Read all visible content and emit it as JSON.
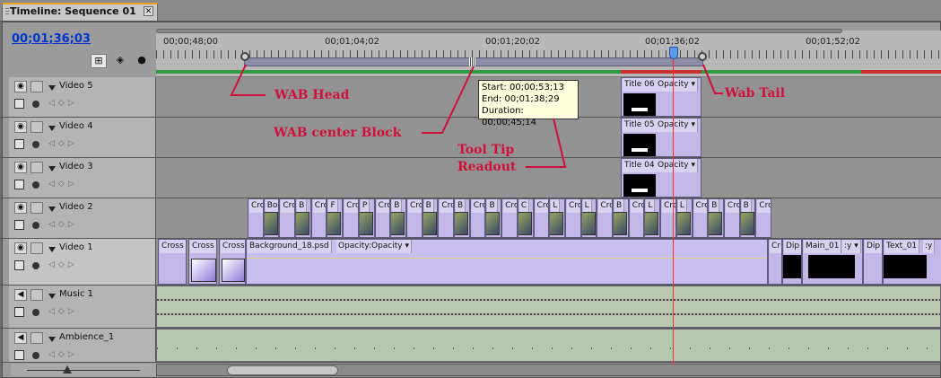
{
  "window": {
    "tab_title": "Timeline: Sequence 01",
    "close_glyph": "✕"
  },
  "timecode": "00;01;36;03",
  "ruler_labels": [
    "00;00;48;00",
    "00;01;04;02",
    "00;01;20;02",
    "00;01;36;02",
    "00;01;52;02"
  ],
  "tooltip": {
    "start": "Start: 00;00;53;13",
    "end": "End: 00;01;38;29",
    "duration": "Duration: 00;00;45;14"
  },
  "annotations": {
    "wab_head": "WAB Head",
    "wab_tail": "Wab Tail",
    "wab_center": "WAB center Block",
    "tooltip_readout_1": "Tool Tip",
    "tooltip_readout_2": "Readout"
  },
  "tracks": {
    "video5": "Video 5",
    "video4": "Video 4",
    "video3": "Video 3",
    "video2": "Video 2",
    "video1": "Video 1",
    "music1": "Music 1",
    "ambience1": "Ambience_1"
  },
  "clips": {
    "title06": "Title 06",
    "title05": "Title 05",
    "title04": "Title 04",
    "opacity": "Opacity ▾",
    "cross": "Cross",
    "background": "Background_18.psd",
    "bg_opacity": "Opacity:Opacity ▾",
    "cr": "Cr",
    "dip": "Dip",
    "main01": "Main_01",
    "y": ":y ▾",
    "text01": "Text_01",
    "text01_y": ":y"
  },
  "video2_labels": [
    "Cros",
    "Bo",
    "Cro",
    "B",
    "Cro",
    "F",
    "Cro",
    "P",
    "Cro",
    "B",
    "Cro",
    "B",
    "Cro",
    "B",
    "Cro",
    "B",
    "Cro",
    "C",
    "Cro",
    "L",
    "Cro",
    "L",
    "Cro",
    "B",
    "Cro",
    "L",
    "Cro",
    "L",
    "Cro",
    "B",
    "Cro",
    "B",
    "Cro"
  ],
  "colors": {
    "accent": "#e8a21e",
    "timecode": "#0035d0",
    "playhead": "#ff2a2a",
    "annotation": "#d0103a",
    "clip": "#c3b7e8",
    "green_bar": "#2e9c44"
  },
  "icons": {
    "snap": "snap-icon",
    "marker": "marker-icon",
    "eye": "eye-icon",
    "speaker": "speaker-icon",
    "lock": "lock-icon"
  }
}
